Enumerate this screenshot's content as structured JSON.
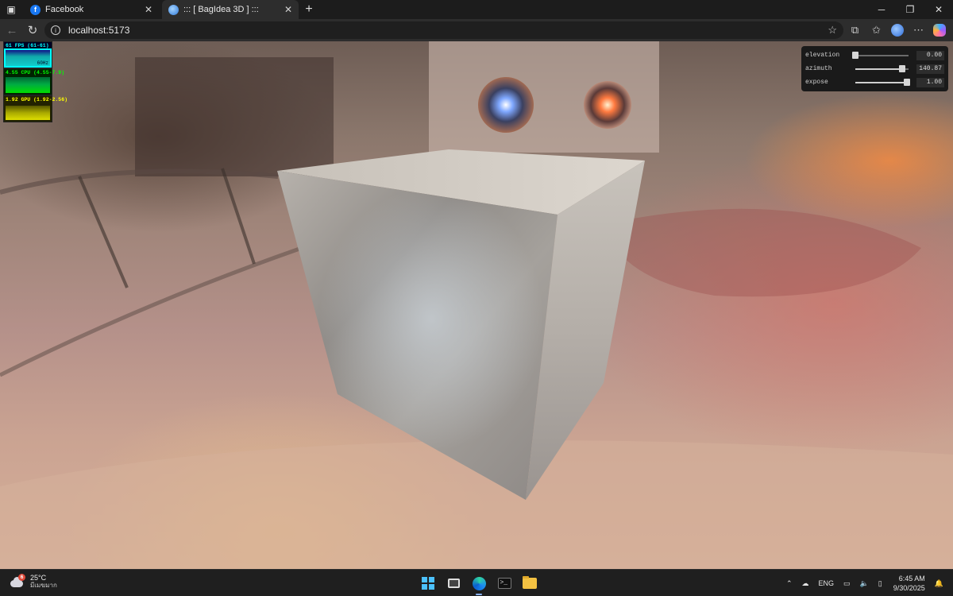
{
  "browser": {
    "tabs": [
      {
        "title": "Facebook",
        "icon": "facebook-icon",
        "active": false
      },
      {
        "title": "::: [ BagIdea 3D ] :::",
        "icon": "globe-icon",
        "active": true
      }
    ],
    "url": "localhost:5173"
  },
  "stats": {
    "fps": {
      "label": "61 FPS (61-61)",
      "sub": "60Hz"
    },
    "cpu": {
      "label": "4.55 CPU (4.55-7.9)"
    },
    "gpu": {
      "label": "1.92 GPU (1.92-2.56)"
    }
  },
  "gui": {
    "controls": [
      {
        "name": "elevation",
        "value": "0.00",
        "level": 0.0
      },
      {
        "name": "azimuth",
        "value": "140.87",
        "level": 0.88
      },
      {
        "name": "expose",
        "value": "1.00",
        "level": 0.98
      }
    ]
  },
  "taskbar": {
    "weather": {
      "temp": "25°C",
      "condition": "มีเมฆมาก",
      "badge": "6"
    },
    "language": "ENG",
    "time": "6:45 AM",
    "date": "9/30/2025"
  },
  "colors": {
    "cpu_graph": "#00ff00",
    "fps_graph": "#00ffff",
    "gpu_graph": "#ffff00",
    "accent": "#4cc2ff"
  }
}
